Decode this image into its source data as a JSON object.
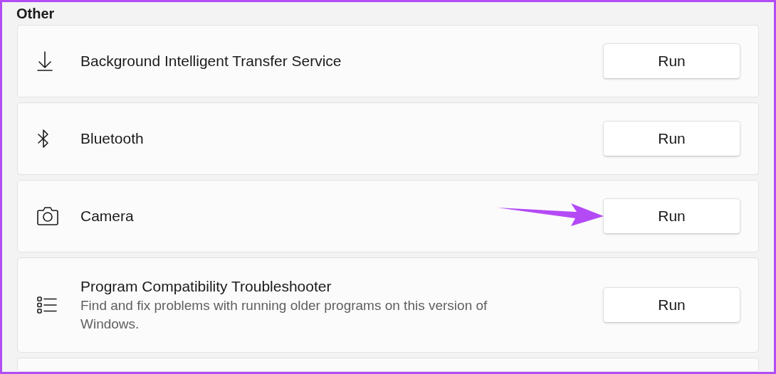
{
  "section": {
    "title": "Other"
  },
  "items": [
    {
      "title": "Background Intelligent Transfer Service",
      "button": "Run",
      "annotated": false
    },
    {
      "title": "Bluetooth",
      "button": "Run",
      "annotated": false
    },
    {
      "title": "Camera",
      "button": "Run",
      "annotated": true
    },
    {
      "title": "Program Compatibility Troubleshooter",
      "description": "Find and fix problems with running older programs on this version of Windows.",
      "button": "Run",
      "annotated": false
    }
  ]
}
